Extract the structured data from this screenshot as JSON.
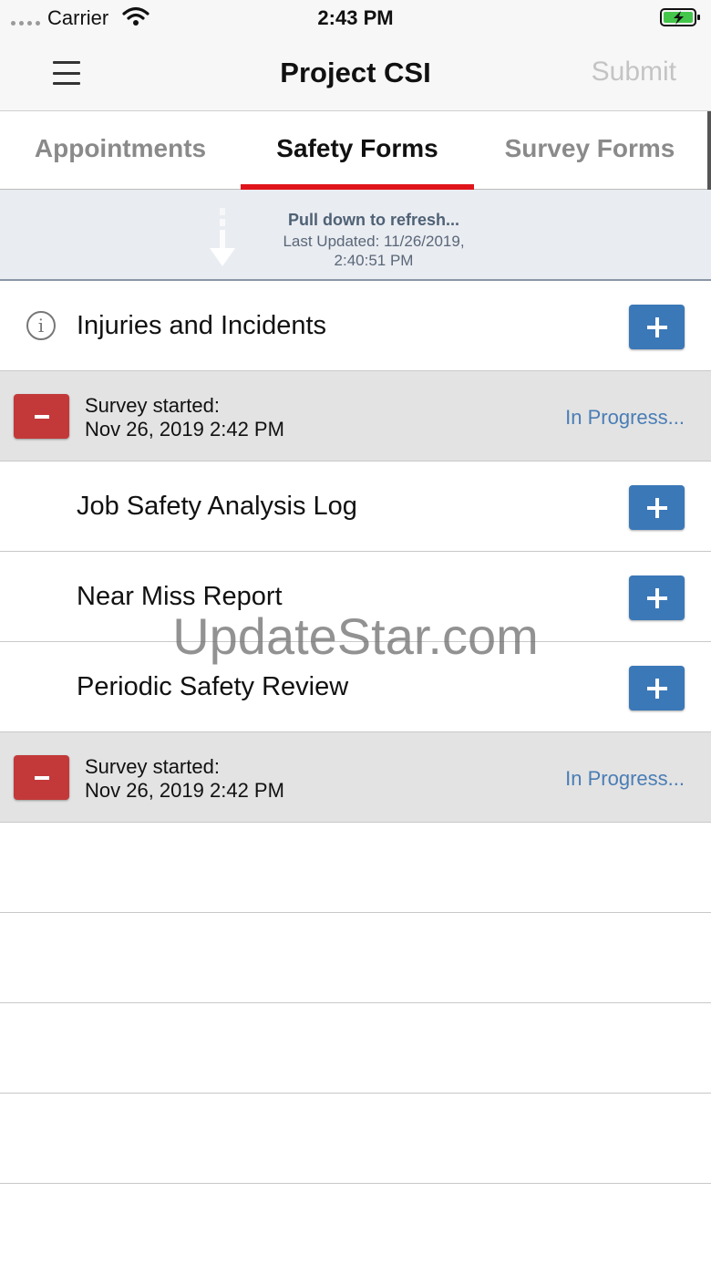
{
  "status_bar": {
    "carrier": "Carrier",
    "time": "2:43 PM",
    "icons": [
      "signal-dots",
      "wifi-icon",
      "battery-charging-icon"
    ]
  },
  "nav": {
    "title": "Project CSI",
    "submit_label": "Submit",
    "menu_icon": "hamburger-menu-icon"
  },
  "tabs": [
    {
      "label": "Appointments",
      "active": false
    },
    {
      "label": "Safety Forms",
      "active": true
    },
    {
      "label": "Survey Forms",
      "active": false
    }
  ],
  "refresh": {
    "title": "Pull down to refresh...",
    "line1": "Last Updated: 11/26/2019,",
    "line2": "2:40:51 PM"
  },
  "forms": [
    {
      "label": "Injuries and Incidents",
      "has_info_icon": true
    },
    {
      "label": "Job Safety Analysis Log"
    },
    {
      "label": "Near Miss Report"
    },
    {
      "label": "Periodic Safety Review"
    }
  ],
  "surveys": [
    {
      "line1": "Survey started:",
      "line2": "Nov 26, 2019 2:42 PM",
      "status": "In Progress..."
    },
    {
      "line1": "Survey started:",
      "line2": "Nov 26, 2019 2:42 PM",
      "status": "In Progress..."
    }
  ],
  "watermark": "UpdateStar.com",
  "colors": {
    "accent_red": "#e0151b",
    "add_blue": "#3b78b8",
    "remove_red": "#c3393a",
    "link_blue": "#4a7db5"
  }
}
